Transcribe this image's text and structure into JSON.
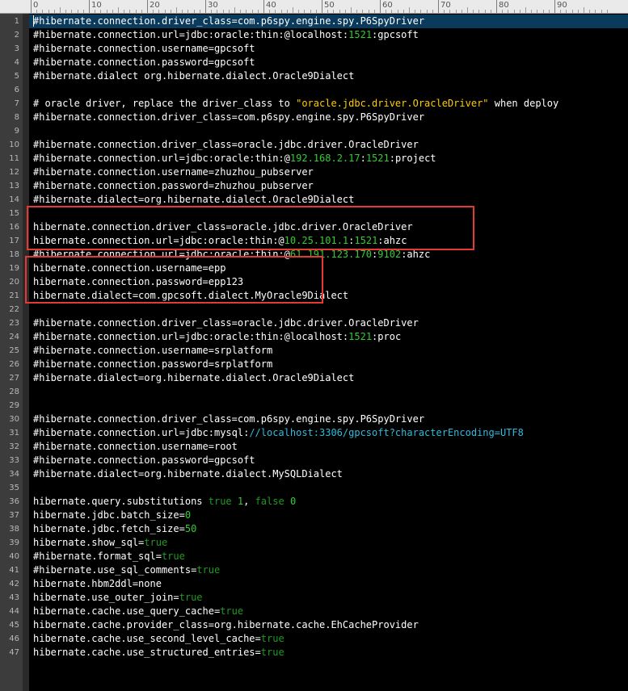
{
  "ruler": {
    "labels": [
      "0",
      "10",
      "20",
      "30",
      "40",
      "50",
      "60",
      "70",
      "80",
      "90"
    ]
  },
  "editor": {
    "lines": [
      {
        "n": "1",
        "tokens": [
          {
            "t": "#hibernate.connection.driver_class=com.p6spy.engine.spy.P6SpyDriver",
            "c": "text"
          }
        ]
      },
      {
        "n": "2",
        "tokens": [
          {
            "t": "#hibernate.connection.url=jdbc:oracle:thin:@localhost:",
            "c": "text"
          },
          {
            "t": "1521",
            "c": "num"
          },
          {
            "t": ":gpcsoft",
            "c": "text"
          }
        ]
      },
      {
        "n": "3",
        "tokens": [
          {
            "t": "#hibernate.connection.username=gpcsoft",
            "c": "text"
          }
        ]
      },
      {
        "n": "4",
        "tokens": [
          {
            "t": "#hibernate.connection.password=gpcsoft",
            "c": "text"
          }
        ]
      },
      {
        "n": "5",
        "tokens": [
          {
            "t": "#hibernate.dialect org.hibernate.dialect.Oracle9Dialect",
            "c": "text"
          }
        ]
      },
      {
        "n": "6",
        "tokens": []
      },
      {
        "n": "7",
        "tokens": [
          {
            "t": "# oracle driver, replace the driver_class to ",
            "c": "text"
          },
          {
            "t": "\"oracle.jdbc.driver.OracleDriver\"",
            "c": "str"
          },
          {
            "t": " when deploy",
            "c": "text"
          }
        ]
      },
      {
        "n": "8",
        "tokens": [
          {
            "t": "#hibernate.connection.driver_class=com.p6spy.engine.spy.P6SpyDriver",
            "c": "text"
          }
        ]
      },
      {
        "n": "9",
        "tokens": []
      },
      {
        "n": "10",
        "tokens": [
          {
            "t": "#hibernate.connection.driver_class=oracle.jdbc.driver.OracleDriver",
            "c": "text"
          }
        ]
      },
      {
        "n": "11",
        "tokens": [
          {
            "t": "#hibernate.connection.url=jdbc:oracle:thin:@",
            "c": "text"
          },
          {
            "t": "192.168.2.17",
            "c": "num"
          },
          {
            "t": ":",
            "c": "text"
          },
          {
            "t": "1521",
            "c": "num"
          },
          {
            "t": ":project",
            "c": "text"
          }
        ]
      },
      {
        "n": "12",
        "tokens": [
          {
            "t": "#hibernate.connection.username=zhuzhou_pubserver",
            "c": "text"
          }
        ]
      },
      {
        "n": "13",
        "tokens": [
          {
            "t": "#hibernate.connection.password=zhuzhou_pubserver",
            "c": "text"
          }
        ]
      },
      {
        "n": "14",
        "tokens": [
          {
            "t": "#hibernate.dialect=org.hibernate.dialect.Oracle9Dialect",
            "c": "text"
          }
        ]
      },
      {
        "n": "15",
        "tokens": []
      },
      {
        "n": "16",
        "tokens": [
          {
            "t": "hibernate.connection.driver_class=oracle.jdbc.driver.OracleDriver",
            "c": "text"
          }
        ]
      },
      {
        "n": "17",
        "tokens": [
          {
            "t": "hibernate.connection.url=jdbc:oracle:thin:@",
            "c": "text"
          },
          {
            "t": "10.25.101.1",
            "c": "num"
          },
          {
            "t": ":",
            "c": "text"
          },
          {
            "t": "1521",
            "c": "num"
          },
          {
            "t": ":ahzc",
            "c": "text"
          }
        ]
      },
      {
        "n": "18",
        "tokens": [
          {
            "t": "#hibernate.connection.url=jdbc:oracle:thin:@",
            "c": "text"
          },
          {
            "t": "61.191.123.170",
            "c": "num"
          },
          {
            "t": ":",
            "c": "text"
          },
          {
            "t": "9102",
            "c": "num"
          },
          {
            "t": ":ahzc",
            "c": "text"
          }
        ]
      },
      {
        "n": "19",
        "tokens": [
          {
            "t": "hibernate.connection.username=epp",
            "c": "text"
          }
        ]
      },
      {
        "n": "20",
        "tokens": [
          {
            "t": "hibernate.connection.password=epp123",
            "c": "text"
          }
        ]
      },
      {
        "n": "21",
        "tokens": [
          {
            "t": "hibernate.dialect=com.gpcsoft.dialect.MyOracle9Dialect",
            "c": "text"
          }
        ]
      },
      {
        "n": "22",
        "tokens": []
      },
      {
        "n": "23",
        "tokens": [
          {
            "t": "#hibernate.connection.driver_class=oracle.jdbc.driver.OracleDriver",
            "c": "text"
          }
        ]
      },
      {
        "n": "24",
        "tokens": [
          {
            "t": "#hibernate.connection.url=jdbc:oracle:thin:@localhost:",
            "c": "text"
          },
          {
            "t": "1521",
            "c": "num"
          },
          {
            "t": ":proc",
            "c": "text"
          }
        ]
      },
      {
        "n": "25",
        "tokens": [
          {
            "t": "#hibernate.connection.username=srplatform",
            "c": "text"
          }
        ]
      },
      {
        "n": "26",
        "tokens": [
          {
            "t": "#hibernate.connection.password=srplatform",
            "c": "text"
          }
        ]
      },
      {
        "n": "27",
        "tokens": [
          {
            "t": "#hibernate.dialect=org.hibernate.dialect.Oracle9Dialect",
            "c": "text"
          }
        ]
      },
      {
        "n": "28",
        "tokens": []
      },
      {
        "n": "29",
        "tokens": []
      },
      {
        "n": "30",
        "tokens": [
          {
            "t": "#hibernate.connection.driver_class=com.p6spy.engine.spy.P6SpyDriver",
            "c": "text"
          }
        ]
      },
      {
        "n": "31",
        "tokens": [
          {
            "t": "#hibernate.connection.url=jdbc:mysql:",
            "c": "text"
          },
          {
            "t": "//localhost:3306/gpcsoft?characterEncoding=UTF8",
            "c": "url"
          }
        ]
      },
      {
        "n": "32",
        "tokens": [
          {
            "t": "#hibernate.connection.username=root",
            "c": "text"
          }
        ]
      },
      {
        "n": "33",
        "tokens": [
          {
            "t": "#hibernate.connection.password=gpcsoft",
            "c": "text"
          }
        ]
      },
      {
        "n": "34",
        "tokens": [
          {
            "t": "#hibernate.dialect=org.hibernate.dialect.MySQLDialect",
            "c": "text"
          }
        ]
      },
      {
        "n": "35",
        "tokens": []
      },
      {
        "n": "36",
        "tokens": [
          {
            "t": "hibernate.query.substitutions ",
            "c": "text"
          },
          {
            "t": "true",
            "c": "kw"
          },
          {
            "t": " ",
            "c": "text"
          },
          {
            "t": "1",
            "c": "num"
          },
          {
            "t": ", ",
            "c": "text"
          },
          {
            "t": "false",
            "c": "kw"
          },
          {
            "t": " ",
            "c": "text"
          },
          {
            "t": "0",
            "c": "num"
          }
        ]
      },
      {
        "n": "37",
        "tokens": [
          {
            "t": "hibernate.jdbc.batch_size=",
            "c": "text"
          },
          {
            "t": "0",
            "c": "num"
          }
        ]
      },
      {
        "n": "38",
        "tokens": [
          {
            "t": "hibernate.jdbc.fetch_size=",
            "c": "text"
          },
          {
            "t": "50",
            "c": "num"
          }
        ]
      },
      {
        "n": "39",
        "tokens": [
          {
            "t": "hibernate.show_sql=",
            "c": "text"
          },
          {
            "t": "true",
            "c": "kw"
          }
        ]
      },
      {
        "n": "40",
        "tokens": [
          {
            "t": "#hibernate.format_sql=",
            "c": "text"
          },
          {
            "t": "true",
            "c": "kw"
          }
        ]
      },
      {
        "n": "41",
        "tokens": [
          {
            "t": "#hibernate.use_sql_comments=",
            "c": "text"
          },
          {
            "t": "true",
            "c": "kw"
          }
        ]
      },
      {
        "n": "42",
        "tokens": [
          {
            "t": "hibernate.hbm2ddl=none",
            "c": "text"
          }
        ]
      },
      {
        "n": "43",
        "tokens": [
          {
            "t": "hibernate.use_outer_join=",
            "c": "text"
          },
          {
            "t": "true",
            "c": "kw"
          }
        ]
      },
      {
        "n": "44",
        "tokens": [
          {
            "t": "hibernate.cache.use_query_cache=",
            "c": "text"
          },
          {
            "t": "true",
            "c": "kw"
          }
        ]
      },
      {
        "n": "45",
        "tokens": [
          {
            "t": "hibernate.cache.provider_class=org.hibernate.cache.EhCacheProvider",
            "c": "text"
          }
        ]
      },
      {
        "n": "46",
        "tokens": [
          {
            "t": "hibernate.cache.use_second_level_cache=",
            "c": "text"
          },
          {
            "t": "true",
            "c": "kw"
          }
        ]
      },
      {
        "n": "47",
        "tokens": [
          {
            "t": "hibernate.cache.use_structured_entries=",
            "c": "text"
          },
          {
            "t": "true",
            "c": "kw"
          }
        ]
      }
    ]
  },
  "current_line": 1
}
